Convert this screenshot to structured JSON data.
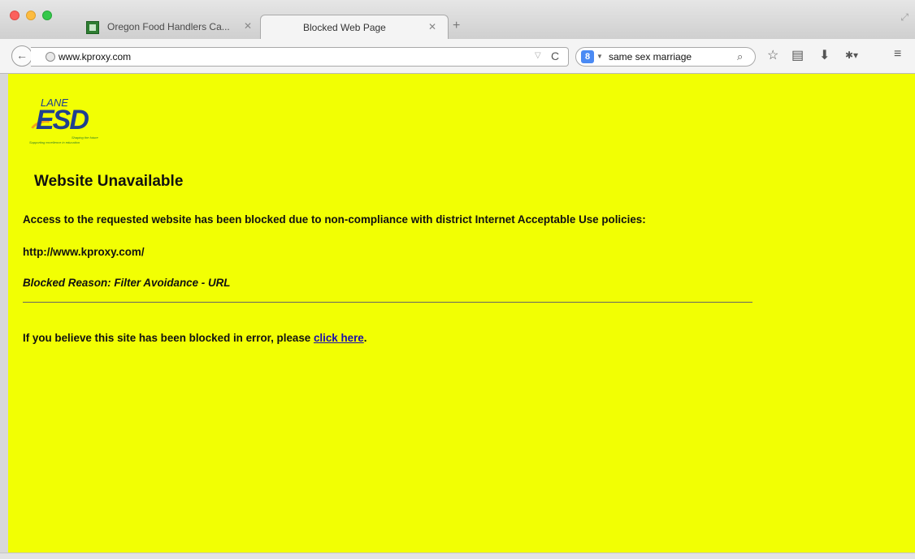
{
  "browser": {
    "tabs": [
      {
        "title": "Oregon Food Handlers Ca...",
        "active": false
      },
      {
        "title": "Blocked Web Page",
        "active": true
      }
    ],
    "new_tab_icon": "plus-icon",
    "url": "www.kproxy.com",
    "search": {
      "engine_icon": "google-icon",
      "engine_letter": "8",
      "value": "same sex marriage"
    },
    "toolbar_icons": [
      "bookmark-star-icon",
      "reading-list-icon",
      "download-icon",
      "addon-icon",
      "menu-icon"
    ]
  },
  "page": {
    "logo": {
      "line1": "LANE",
      "line2": "ESD",
      "tagline1": "Shaping the future",
      "tagline2": "Supporting excellence in education"
    },
    "heading": "Website Unavailable",
    "message": "Access to the requested website has been blocked due to non-compliance with district Internet Acceptable Use policies:",
    "blocked_url": "http://www.kproxy.com/",
    "reason": "Blocked Reason: Filter Avoidance - URL",
    "appeal_prefix": "If you believe this site has been blocked in error, please ",
    "appeal_link": "click here",
    "appeal_suffix": "."
  },
  "colors": {
    "page_background": "#f2ff03",
    "link": "#1a0dab"
  }
}
